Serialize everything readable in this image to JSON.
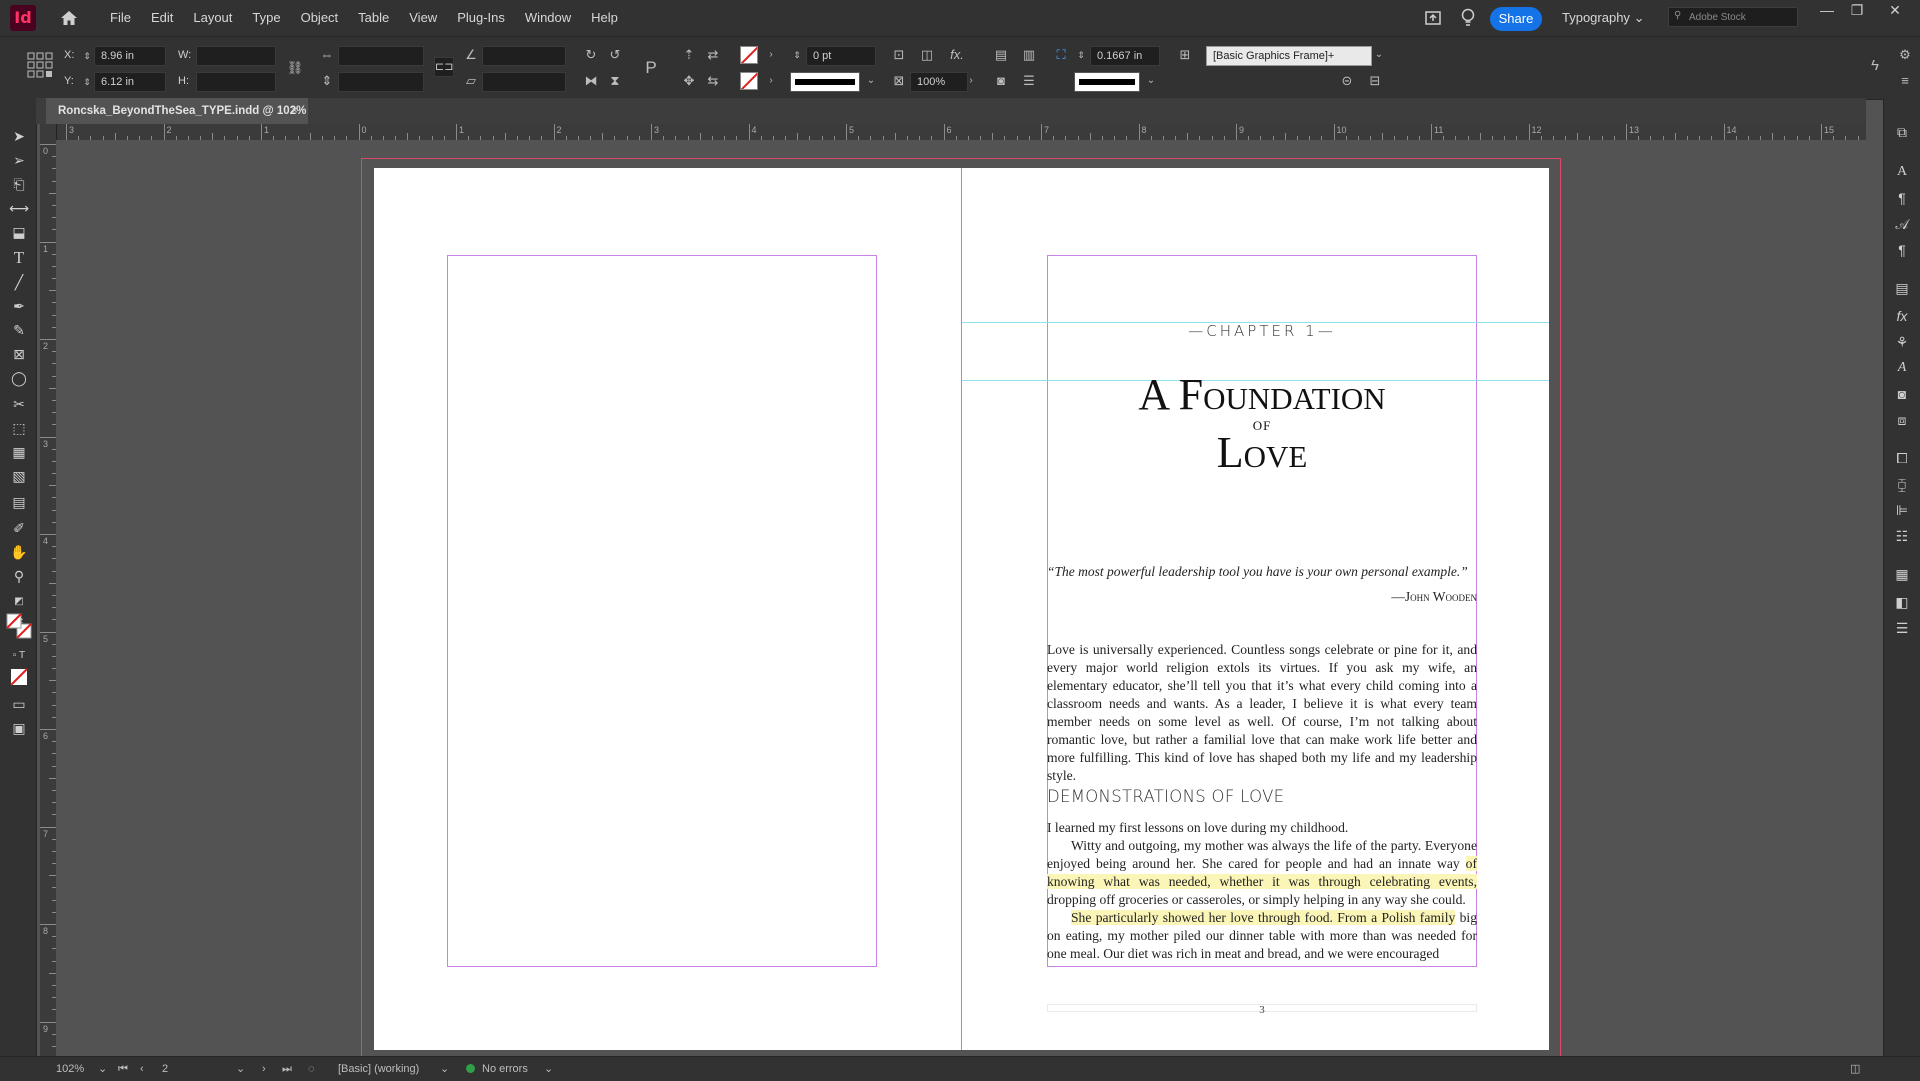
{
  "app": {
    "logo": "Id",
    "menus": [
      "File",
      "Edit",
      "Layout",
      "Type",
      "Object",
      "Table",
      "View",
      "Plug-Ins",
      "Window",
      "Help"
    ],
    "share_label": "Share",
    "workspace": "Typography",
    "stock_placeholder": "Adobe Stock",
    "controls": {
      "minimize": "—",
      "restore": "❐",
      "close": "✕"
    }
  },
  "control_panel": {
    "x_label": "X:",
    "x_value": "8.96 in",
    "y_label": "Y:",
    "y_value": "6.12 in",
    "w_label": "W:",
    "w_value": "",
    "h_label": "H:",
    "h_value": "",
    "stroke_weight": "0 pt",
    "scale": "100%",
    "offset": "0.1667 in",
    "object_style": "[Basic Graphics Frame]+",
    "fill_color": "none",
    "stroke_color": "none"
  },
  "document": {
    "tab_title": "Roncska_BeyondTheSea_TYPE.indd @ 102%",
    "tab_close": "×"
  },
  "ruler": {
    "h_numbers": [
      "3",
      "2",
      "1",
      "0",
      "1",
      "2",
      "3",
      "4",
      "5",
      "6",
      "7",
      "8",
      "9",
      "10",
      "11",
      "12",
      "13",
      "14",
      "15"
    ],
    "v_numbers": [
      "0",
      "1",
      "2",
      "3",
      "4",
      "5",
      "6",
      "7",
      "8",
      "9"
    ]
  },
  "page": {
    "chapter_label": "—CHAPTER 1—",
    "title_line1": "A Foundation",
    "title_of": "OF",
    "title_line2": "Love",
    "quote": "“The most powerful leadership tool you have is your own personal example.”",
    "attribution": "—John Wooden",
    "intro_paragraph": "Love is universally experienced. Countless songs celebrate or pine for it, and every major world religion extols its virtues. If you ask my wife, an elementary educator, she’ll tell you that it’s what every child coming into a classroom needs and wants. As a leader, I believe it is what every team member needs on some level as well. Of course, I’m not talking about romantic love, but rather a familial love that can make work life better and more fulfilling. This kind of love has shaped both my life and my leadership style.",
    "section_heading": "DEMONSTRATIONS OF LOVE",
    "para1": "I learned my first lessons on love during my childhood.",
    "para2_a": "Witty and outgoing, my mother was always the life of the party. Everyone enjoyed being around her. She cared for people and had an innate way",
    "para2_hl": "of knowing what was needed, whether it was through celebrating events,",
    "para2_b": "dropping off groceries or casseroles, or simply helping in any way she could.",
    "para3_hl": "She particularly showed her love through food. From a Polish family",
    "para3_b": "big on eating, my mother piled our dinner table with more than was needed for one meal. Our diet was rich in meat and bread, and we were encouraged",
    "folio": "3"
  },
  "status": {
    "zoom": "102%",
    "page": "2",
    "preflight_profile": "[Basic] (working)",
    "errors": "No errors"
  },
  "colors": {
    "accent": "#1473e6",
    "margin_guide": "#c983e3",
    "bleed_guide": "#d94a64",
    "baseline_guide": "#8de3f0",
    "highlight": "#fbf6b8",
    "app_brand": "#ff3366"
  }
}
